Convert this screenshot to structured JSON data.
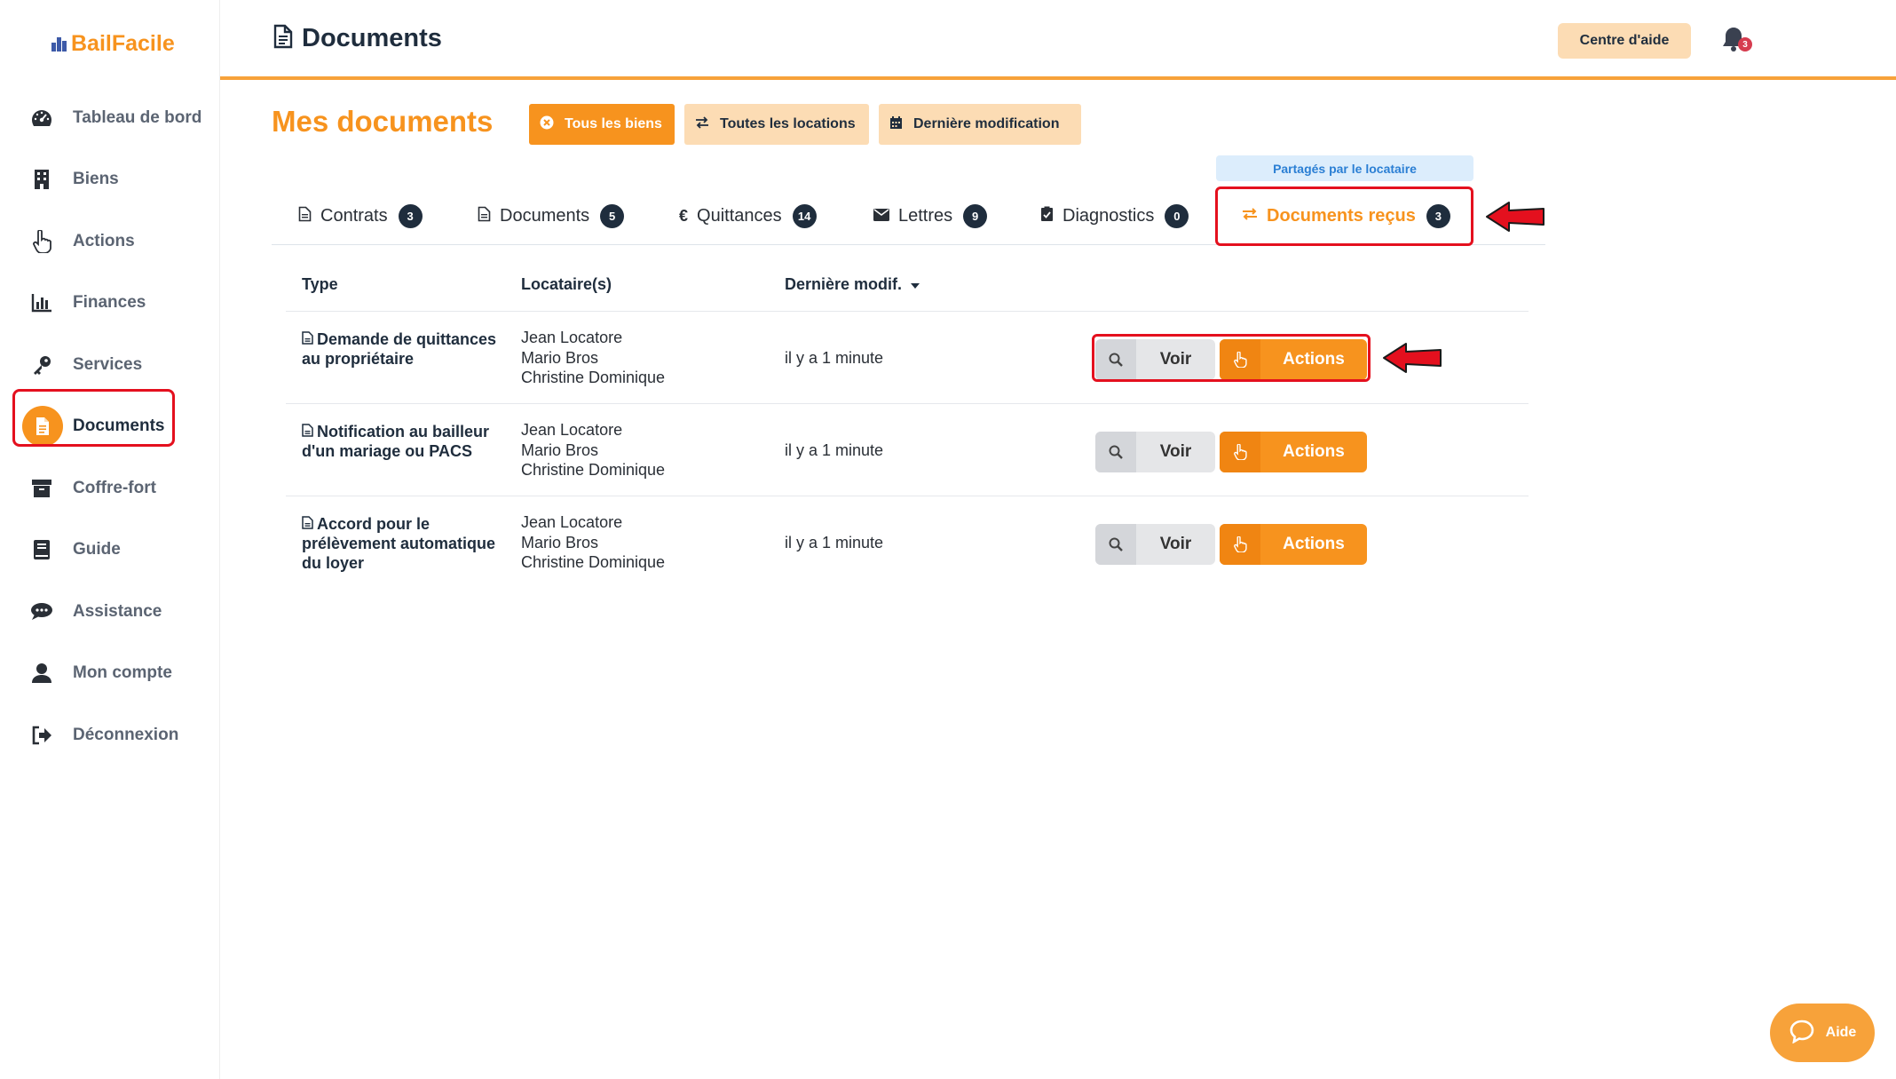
{
  "app": {
    "name": "BailFacile"
  },
  "sidebar": {
    "items": [
      {
        "label": "Tableau de bord",
        "icon": "gauge-icon"
      },
      {
        "label": "Biens",
        "icon": "building-icon"
      },
      {
        "label": "Actions",
        "icon": "pointer-hand-icon"
      },
      {
        "label": "Finances",
        "icon": "bar-chart-icon"
      },
      {
        "label": "Services",
        "icon": "key-icon"
      },
      {
        "label": "Documents",
        "icon": "document-icon",
        "active": true
      },
      {
        "label": "Coffre-fort",
        "icon": "archive-icon"
      },
      {
        "label": "Guide",
        "icon": "book-icon"
      },
      {
        "label": "Assistance",
        "icon": "chat-icon"
      },
      {
        "label": "Mon compte",
        "icon": "user-icon"
      },
      {
        "label": "Déconnexion",
        "icon": "logout-icon"
      }
    ]
  },
  "header": {
    "title": "Documents",
    "help_center": "Centre d'aide",
    "notifications_count": "3"
  },
  "main": {
    "section_title": "Mes documents",
    "filters": {
      "all_properties": "Tous les biens",
      "all_rentals": "Toutes les locations",
      "last_modified": "Dernière modification"
    },
    "shared_badge": "Partagés par le locataire",
    "tabs": [
      {
        "label": "Contrats",
        "count": "3",
        "icon": "document-icon"
      },
      {
        "label": "Documents",
        "count": "5",
        "icon": "document-icon"
      },
      {
        "label": "Quittances",
        "count": "14",
        "icon": "euro-icon"
      },
      {
        "label": "Lettres",
        "count": "9",
        "icon": "envelope-icon"
      },
      {
        "label": "Diagnostics",
        "count": "0",
        "icon": "clipboard-check-icon"
      },
      {
        "label": "Documents reçus",
        "count": "3",
        "icon": "exchange-icon",
        "active": true
      }
    ],
    "table": {
      "columns": {
        "type": "Type",
        "tenants": "Locataire(s)",
        "modified": "Dernière modif."
      },
      "rows": [
        {
          "type": "Demande de quittances au propriétaire",
          "tenants": [
            "Jean Locatore",
            "Mario Bros",
            "Christine Dominique"
          ],
          "modified": "il y a 1 minute",
          "view": "Voir",
          "actions": "Actions"
        },
        {
          "type": "Notification au bailleur d'un mariage ou PACS",
          "tenants": [
            "Jean Locatore",
            "Mario Bros",
            "Christine Dominique"
          ],
          "modified": "il y a 1 minute",
          "view": "Voir",
          "actions": "Actions"
        },
        {
          "type": "Accord pour le prélèvement automatique du loyer",
          "tenants": [
            "Jean Locatore",
            "Mario Bros",
            "Christine Dominique"
          ],
          "modified": "il y a 1 minute",
          "view": "Voir",
          "actions": "Actions"
        }
      ]
    }
  },
  "help_widget": {
    "label": "Aide"
  },
  "colors": {
    "accent": "#f7931e",
    "accent_light": "#fcdcb4",
    "highlight_red": "#e4101e",
    "dark": "#1f2d3d"
  }
}
